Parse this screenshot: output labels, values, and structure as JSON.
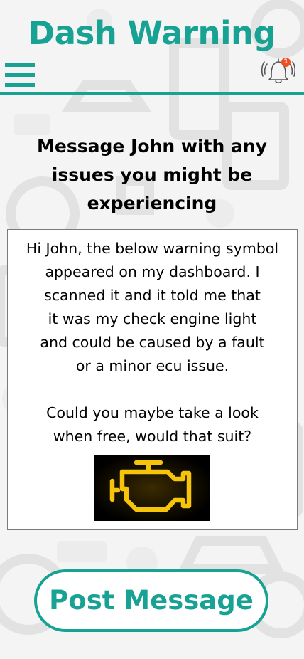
{
  "header": {
    "title": "Dash Warning",
    "menu_icon": "hamburger-menu-icon",
    "notification_icon": "bell-icon",
    "notification_count": "1"
  },
  "main": {
    "prompt": "Message John with any issues you might be experiencing",
    "message": {
      "text": "Hi John, the below warning symbol\nappeared on my dashboard. I\nscanned it and it told me that\nit was my check engine light\nand could be caused by a fault\nor a minor ecu issue.\n\nCould you maybe take a look\nwhen free, would that suit?",
      "attachment_icon": "check-engine-light-icon"
    },
    "post_button_label": "Post Message"
  },
  "colors": {
    "accent": "#17a293",
    "badge": "#ef4e23",
    "engine_light": "#f6c40a",
    "background": "#f4f4f4"
  }
}
